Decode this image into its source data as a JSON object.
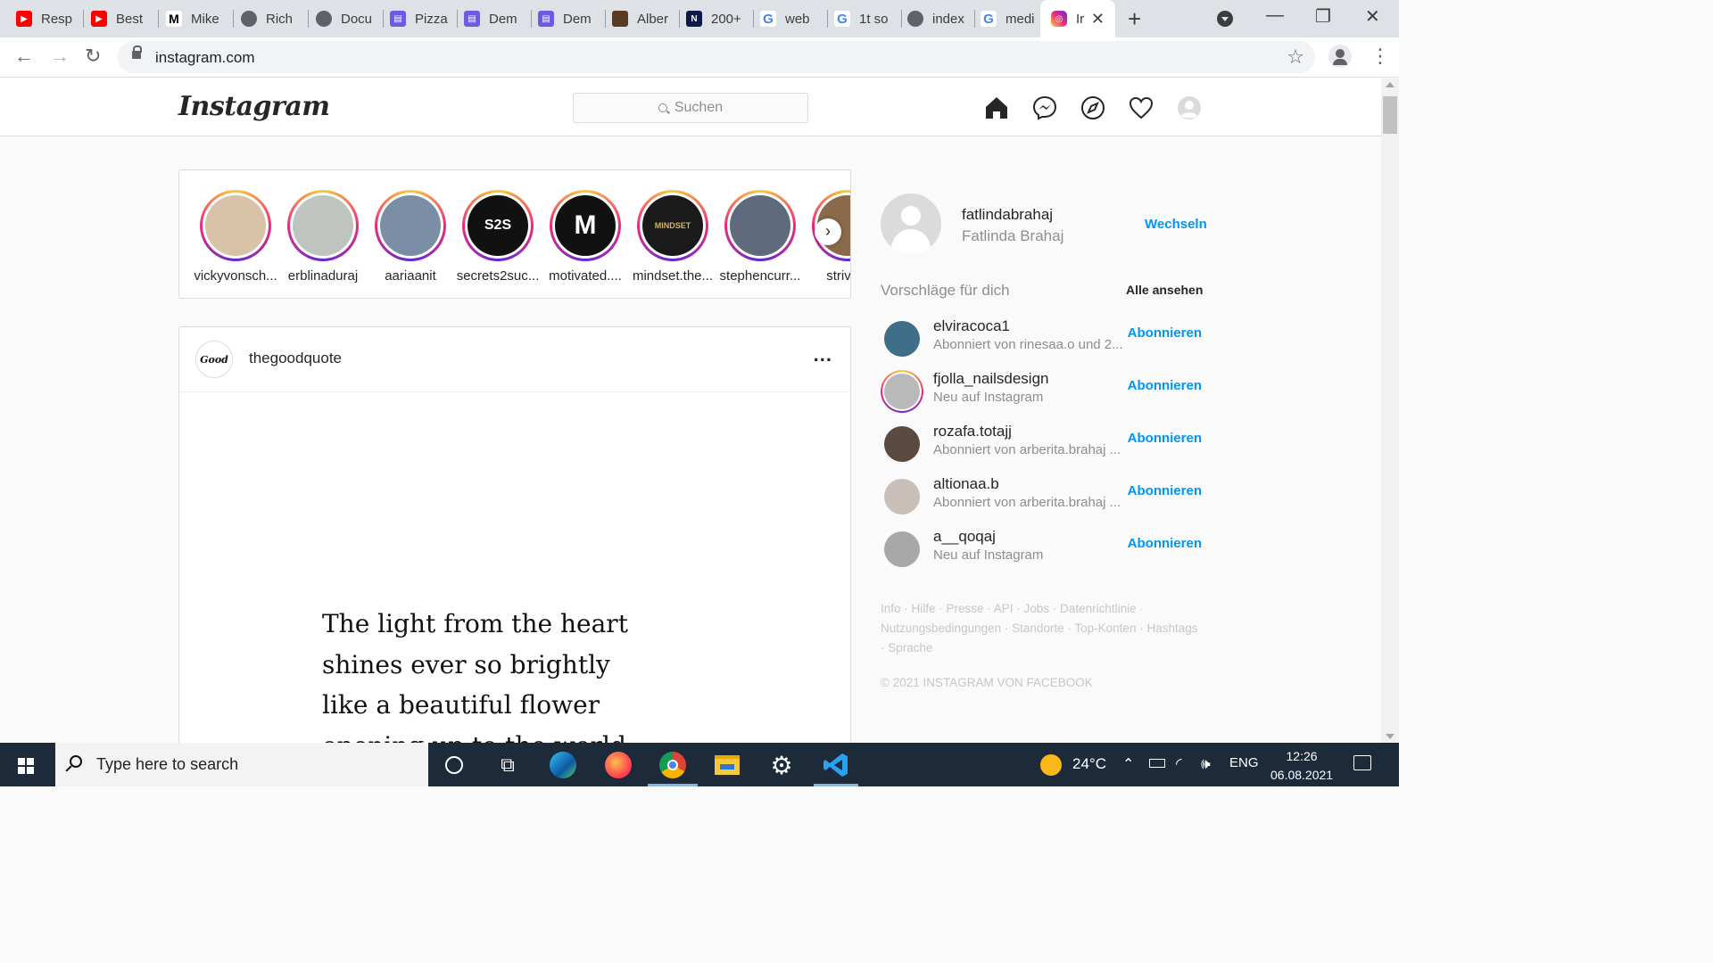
{
  "browser": {
    "tabs": [
      {
        "label": "Resp",
        "favicon": "youtube-icon"
      },
      {
        "label": "Best",
        "favicon": "youtube-icon"
      },
      {
        "label": "Mike",
        "favicon": "mail-icon"
      },
      {
        "label": "Rich",
        "favicon": "globe-icon"
      },
      {
        "label": "Docu",
        "favicon": "globe-icon"
      },
      {
        "label": "Pizza",
        "favicon": "app-icon"
      },
      {
        "label": "Dem",
        "favicon": "app-icon"
      },
      {
        "label": "Dem",
        "favicon": "app-icon"
      },
      {
        "label": "Alber",
        "favicon": "image-icon"
      },
      {
        "label": "200+",
        "favicon": "notion-icon"
      },
      {
        "label": "web",
        "favicon": "google-icon"
      },
      {
        "label": "1t so",
        "favicon": "google-icon"
      },
      {
        "label": "index",
        "favicon": "globe-icon"
      },
      {
        "label": "medi",
        "favicon": "google-icon"
      }
    ],
    "active_tab": {
      "label": "Ir",
      "favicon": "instagram-icon"
    },
    "new_tab": "+",
    "url": "instagram.com",
    "window_controls": {
      "minimize": "—",
      "restore": "❐",
      "close": "✕"
    }
  },
  "instagram": {
    "logo": "Instagram",
    "search_placeholder": "Suchen",
    "stories": [
      {
        "name": "vickyvonsch...",
        "color": "#d8c2a8"
      },
      {
        "name": "erblinaduraj",
        "color": "#bfc4c0"
      },
      {
        "name": "aariaanit",
        "color": "#7a8fa6"
      },
      {
        "name": "secrets2suc...",
        "color": "#111111",
        "mark": "S2S"
      },
      {
        "name": "motivated....",
        "color": "#111111",
        "mark": "M"
      },
      {
        "name": "mindset.the...",
        "color": "#1a1a1a",
        "mark": "MINDSET"
      },
      {
        "name": "stephencurr...",
        "color": "#5f6b7d"
      },
      {
        "name": "striving",
        "color": "#8a6a4a"
      }
    ],
    "post": {
      "username": "thegoodquote",
      "avatar_text": "Good",
      "more": "...",
      "quote_lines": [
        "The light from the heart",
        "shines ever so brightly",
        "like a beautiful flower",
        "opening up to the world"
      ]
    },
    "sidebar": {
      "username": "fatlindabrahaj",
      "full_name": "Fatlinda Brahaj",
      "switch_label": "Wechseln",
      "suggestions_title": "Vorschläge für dich",
      "see_all": "Alle ansehen",
      "suggestions": [
        {
          "username": "elviracoca1",
          "subtitle": "Abonniert von rinesaa.o und 2...",
          "follow": "Abonnieren",
          "color": "#3f6f88"
        },
        {
          "username": "fjolla_nailsdesign",
          "subtitle": "Neu auf Instagram",
          "follow": "Abonnieren",
          "color": "#b9b9b9"
        },
        {
          "username": "rozafa.totajj",
          "subtitle": "Abonniert von arberita.brahaj ...",
          "follow": "Abonnieren",
          "color": "#5a4a40"
        },
        {
          "username": "altionaa.b",
          "subtitle": "Abonniert von arberita.brahaj ...",
          "follow": "Abonnieren",
          "color": "#c9bfb8"
        },
        {
          "username": "a__qoqaj",
          "subtitle": "Neu auf Instagram",
          "follow": "Abonnieren",
          "color": "#a8a8a8"
        }
      ],
      "footer_links": "Info · Hilfe · Presse · API · Jobs · Datenrichtlinie · Nutzungsbedingungen · Standorte · Top-Konten · Hashtags · Sprache",
      "copyright": "© 2021 INSTAGRAM VON FACEBOOK"
    }
  },
  "taskbar": {
    "search_placeholder": "Type here to search",
    "weather": "24°C",
    "language": "ENG",
    "time": "12:26",
    "date": "06.08.2021"
  }
}
